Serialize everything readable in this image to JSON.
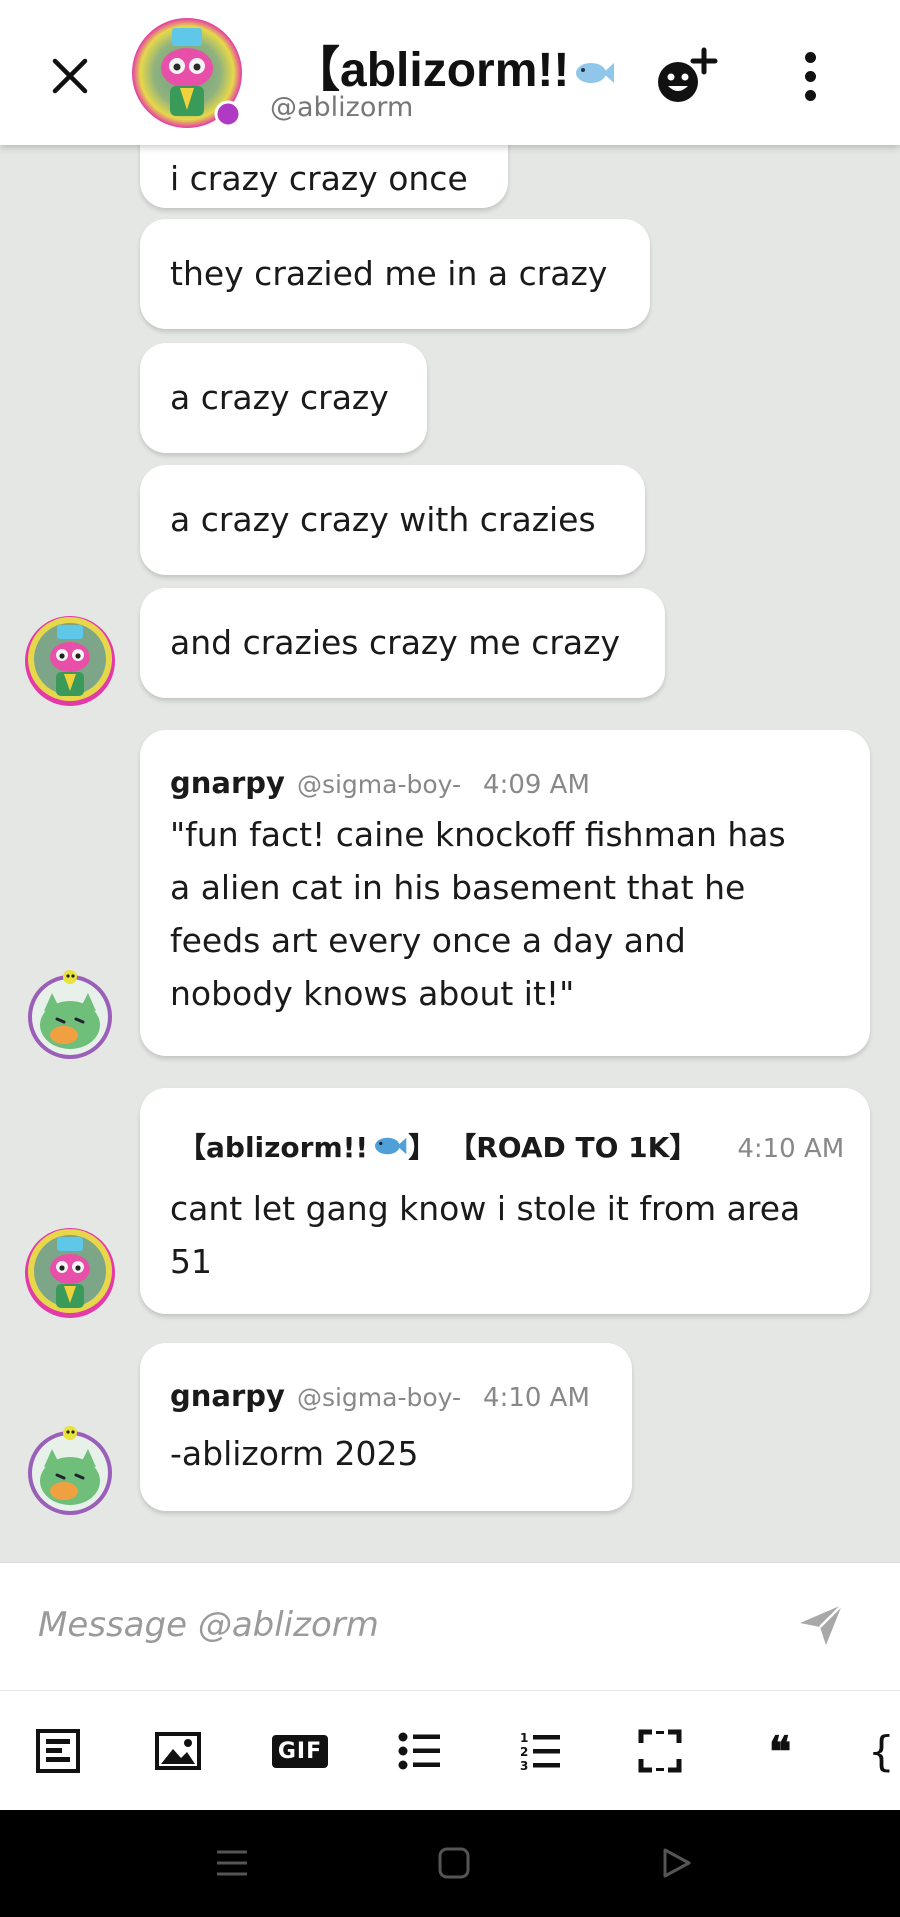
{
  "header": {
    "title": "【ablizorm!!",
    "handle": "@ablizorm",
    "status_color": "#b13ac4"
  },
  "messages": {
    "m1": "i crazy crazy once",
    "m2": "they crazied me in a crazy",
    "m3": "a crazy crazy",
    "m4": "a crazy crazy with crazies",
    "m5": "and crazies crazy me crazy",
    "m6": {
      "author": "gnarpy",
      "handle": "@sigma-boy-",
      "time": "4:09 AM",
      "lines": [
        "\"fun fact! caine knockoff fishman has",
        "a alien cat in his basement that he",
        "feeds art every once a day and",
        "nobody knows about it!\""
      ]
    },
    "m7": {
      "author": "【ablizorm!!",
      "author_suffix": "】",
      "tag": "【ROAD TO 1K】",
      "time": "4:10 AM",
      "lines": [
        "cant let gang know i stole it from area",
        "51"
      ]
    },
    "m8": {
      "author": "gnarpy",
      "handle": "@sigma-boy-",
      "time": "4:10 AM",
      "lines": [
        "-ablizorm 2025"
      ]
    }
  },
  "composer": {
    "placeholder": "Message @ablizorm"
  },
  "toolbar": {
    "items": [
      "bold-format-icon",
      "image-icon",
      "gif-icon",
      "bulleted-list-icon",
      "numbered-list-icon",
      "spoiler-icon",
      "quote-icon",
      "code-icon"
    ],
    "gif_label": "GIF",
    "quote_glyph": "❝",
    "code_glyph": "{"
  },
  "colors": {
    "background": "#e4e7e4",
    "bubble": "#ffffff",
    "muted_text": "#888888"
  }
}
